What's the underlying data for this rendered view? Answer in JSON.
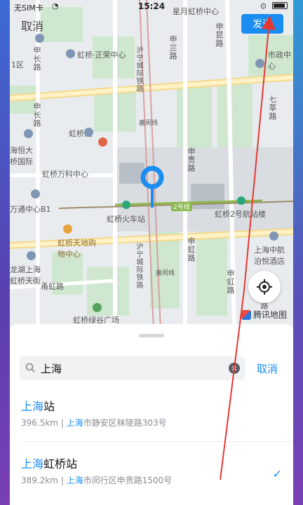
{
  "status_bar": {
    "carrier": "无SIM卡",
    "time": "15:24"
  },
  "topbar": {
    "cancel_label": "取消",
    "send_label": "发送"
  },
  "map": {
    "labels": {
      "xinghong": "星月虹桥中心",
      "shenchang": "申长路",
      "zhengrong": "虹桥·正荣中心",
      "qu1": "1区",
      "shenchang2": "申长路",
      "shenlan": "申兰路",
      "kunlu": "申昆路",
      "shizheng": "市政中心",
      "qixin": "七莘路",
      "hongqiaohui": "虹桥汇",
      "haiqiao": "海恒大桥国际",
      "wanke": "虹桥万科中心",
      "shengui": "申贵路",
      "jiahuo": "嘉闵线",
      "hutong": "沪宁城际铁路",
      "hutong2": "沪宁城际铁路",
      "wantong": "万通中心B1",
      "station": "虹桥火车站",
      "line2": "2号线",
      "terminal2": "虹桥2号航站楼",
      "tiandi": "虹桥天地购物中心",
      "longhu": "龙湖上海虹桥天街",
      "shenhongroad": "申虹路",
      "jiamin2": "嘉闵线",
      "shenyuan": "申虹路",
      "hangzhong": "上海中航泊悦酒店",
      "nanhong": "甬虹路",
      "lvgu": "虹桥绿谷广场",
      "shenbin": "申滨路"
    },
    "brand": "腾讯地图",
    "icons": [
      "locate-icon",
      "map-pin-icon",
      "tencent-map-logo"
    ]
  },
  "search": {
    "value": "上海",
    "cancel_label": "取消"
  },
  "results": [
    {
      "title_hl": "上海",
      "title_rest": "站",
      "distance": "396.5km",
      "sep": " | ",
      "addr_hl": "上海",
      "addr_rest": "市静安区秣陵路303号",
      "selected": false
    },
    {
      "title_hl": "上海",
      "title_rest": "虹桥站",
      "distance": "389.2km",
      "sep": " | ",
      "addr_hl": "上海",
      "addr_rest": "市闵行区申贵路1500号",
      "selected": true
    }
  ],
  "colors": {
    "accent": "#1a8df0",
    "annotation_arrow": "#e53935"
  }
}
